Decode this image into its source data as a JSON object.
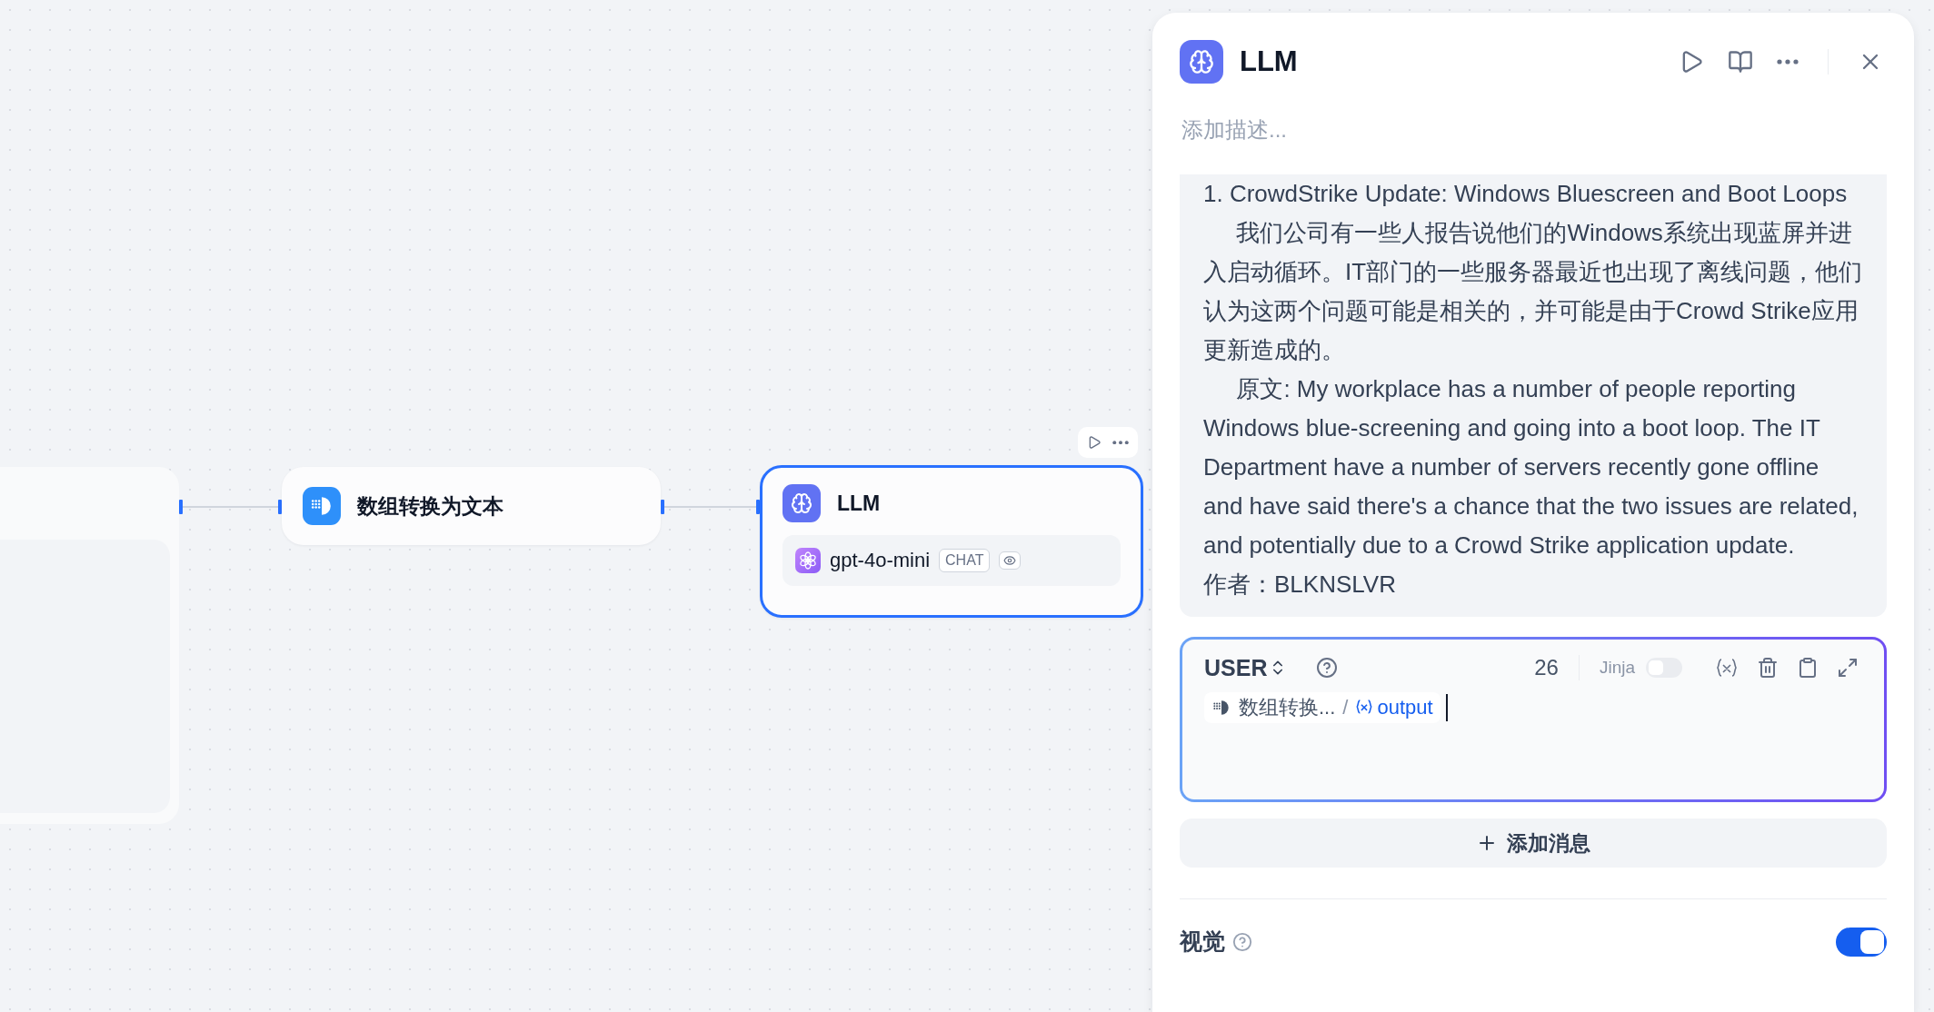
{
  "canvas": {
    "nodes": [
      {
        "kind": "transform",
        "title": "数组转换为文本",
        "selected": false
      },
      {
        "kind": "llm",
        "title": "LLM",
        "selected": true,
        "model": {
          "name": "gpt-4o-mini",
          "mode": "CHAT"
        }
      }
    ]
  },
  "panel": {
    "title": "LLM",
    "description_placeholder": "添加描述...",
    "prompt_paragraphs": [
      {
        "text": "1. CrowdStrike Update: Windows Bluescreen and Boot Loops",
        "indented": false
      },
      {
        "text": "我们公司有一些人报告说他们的Windows系统出现蓝屏并进入启动循环。IT部门的一些服务器最近也出现了离线问题，他们认为这两个问题可能是相关的，并可能是由于Crowd Strike应用更新造成的。",
        "indented": true
      },
      {
        "text": "原文: My workplace has a number of people reporting Windows blue-screening and going into a boot loop. The IT Department have a number of servers recently gone offline and have said there's a chance that the two issues are related, and potentially due to a Crowd Strike application update.",
        "indented": true
      },
      {
        "text": "作者：BLKNSLVR",
        "indented": false
      }
    ],
    "message": {
      "role": "USER",
      "char_count": "26",
      "jinja": {
        "label": "Jinja",
        "on": false
      },
      "variable": {
        "node": "数组转换...",
        "separator": "/",
        "name": "output"
      }
    },
    "add_message": "添加消息",
    "vision": {
      "label": "视觉",
      "on": true
    }
  }
}
